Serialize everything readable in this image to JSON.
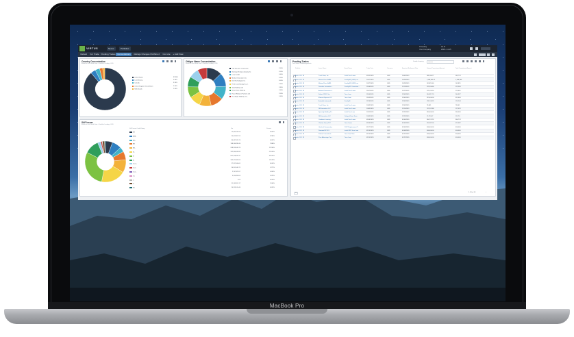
{
  "device": {
    "label": "MacBook Pro"
  },
  "app": {
    "brand": "VIRTUS",
    "breadcrumbs": [
      "Nexus",
      "Portfolios"
    ],
    "company": {
      "caption": "Company",
      "name": "Your Company",
      "date_caption": "As of",
      "date": "2019 • 11-15"
    },
    "tabs": [
      {
        "label": "Default",
        "active": false
      },
      {
        "label": "For Trade",
        "active": false
      },
      {
        "label": "Pending Trades",
        "active": false
      },
      {
        "label": "Concentrations",
        "active": true
      },
      {
        "label": "Ratings Changes",
        "active": false
      },
      {
        "label": "Portfolio 2",
        "active": false
      },
      {
        "label": "Cov Lite",
        "active": false
      },
      {
        "label": "+ Add View",
        "active": false
      }
    ],
    "country": {
      "title": "Country Concentration",
      "subtitle": "Based on Last Settle Date • Portfolio: Lending • USD",
      "legend": [
        {
          "label": "United States",
          "value": "82.86%",
          "color": "#2b3a4d"
        },
        {
          "label": "Luxembourg",
          "value": "3.58%",
          "color": "#2f7fc1"
        },
        {
          "label": "Canada",
          "value": "3.20%",
          "color": "#42b3c8"
        },
        {
          "label": "United Kingdom Great Britain",
          "value": "2.20%",
          "color": "#e6782e"
        },
        {
          "label": "Netherlands",
          "value": "1.50%",
          "color": "#f3b23b"
        }
      ]
    },
    "obligor": {
      "title": "Obligor Name Concentration",
      "subtitle": "Based on Last Settle Date • Portfolio: Lending • USD",
      "legend": [
        {
          "label": "ION Solutions Corporation",
          "value": "3.90%",
          "color": "#2b3a4d"
        },
        {
          "label": "Gateway Energy Company Inc",
          "value": "3.50%",
          "color": "#2f7fc1"
        },
        {
          "label": "Lunar Credit",
          "value": "3.40%",
          "color": "#42b3c8"
        },
        {
          "label": "Medical Innovations Inc",
          "value": "3.20%",
          "color": "#e6782e"
        },
        {
          "label": "Intel Technologies Inc",
          "value": "3.00%",
          "color": "#f3b23b"
        },
        {
          "label": "Fresh Luxembourg S.a.r.l.",
          "value": "2.90%",
          "color": "#f5d547"
        },
        {
          "label": "Total Holdings Ltd",
          "value": "2.80%",
          "color": "#7cc242"
        },
        {
          "label": "Smart Reds Holdings",
          "value": "2.60%",
          "color": "#2f9e5b"
        },
        {
          "label": "Parcel Reliance Partners Ltd",
          "value": "2.50%",
          "color": "#9ad0ec"
        },
        {
          "label": "First Eagle Holdings, Inc.",
          "value": "2.40%",
          "color": "#c63b3b"
        }
      ]
    },
    "sp": {
      "title": "S&P Issuer",
      "subtitle": "Based on Last Settle Date • Portfolio: Lending • USD",
      "col_rating": "S&P Issuer Credit Rating",
      "col_par": "Par",
      "col_pct": "Percent",
      "rows": [
        {
          "rating": "NR",
          "par": "12,462,235.98",
          "pct": "6.644%",
          "color": "#2b3a4d"
        },
        {
          "rating": "BBB-",
          "par": "20,612,857.95",
          "pct": "8.784%",
          "color": "#2f7fc1"
        },
        {
          "rating": "BB+",
          "par": "86,437,926.76",
          "pct": "4.667%",
          "color": "#42b3c8"
        },
        {
          "rating": "BB",
          "par": "138,160,283.40",
          "pct": "7.886%",
          "color": "#e6782e"
        },
        {
          "rating": "BB-",
          "par": "248,353,046.70",
          "pct": "12.200%",
          "color": "#f3b23b"
        },
        {
          "rating": "B+",
          "par": "352,369,633.83",
          "pct": "22.956%",
          "color": "#f5d547"
        },
        {
          "rating": "B",
          "par": "601,108,635.47",
          "pct": "34.992%",
          "color": "#7cc242"
        },
        {
          "rating": "B-",
          "par": "303,222,469.60",
          "pct": "13.528%",
          "color": "#2f9e5b"
        },
        {
          "rating": "CCC+",
          "par": "27,517,060.61",
          "pct": "3.002%",
          "color": "#9ad0ec"
        },
        {
          "rating": "CCC",
          "par": "20,551,543.71",
          "pct": "1.277%",
          "color": "#c63b3b"
        },
        {
          "rating": "CCC-",
          "par": "2,767,427.07",
          "pct": "0.109%",
          "color": "#7a5bb5"
        },
        {
          "rating": "CC",
          "par": "3,100,499.00",
          "pct": "0.125%",
          "color": "#d98bc0"
        },
        {
          "rating": "C",
          "par": "0.00",
          "pct": "0.000%",
          "color": "#b5b5b5"
        },
        {
          "rating": "D",
          "par": "51,145,951.17",
          "pct": "1.966%",
          "color": "#6e4c2e"
        },
        {
          "rating": "SD",
          "par": "24,319,510.44",
          "pct": "0.952%",
          "color": "#1d6b73"
        }
      ]
    },
    "trades": {
      "title": "Pending Trades",
      "subtitle": "Not Closed Trade Assignments",
      "search_placeholder": "Search",
      "grouping_label": "Disable Grouping",
      "headers": [
        "Portfolio",
        "Issuer Name",
        "Asset Name",
        "Trade Date",
        "Currency",
        "Expected Settlement Date",
        "Original Commitment Amount",
        "Total Commitment Amount"
      ],
      "rows": [
        [
          "Aretic CLO 18",
          "Truck Nano, Inc.",
          "Initial Term Loans",
          "09/25/2019",
          "USD",
          "10/03/2019",
          "581,984.77",
          "581,774"
        ],
        [
          "Aretic CLO 18",
          "Melaso Pinco SARL",
          "Facility B1 (USD) Loa",
          "10/17/2019",
          "USD",
          "10/28/2019",
          "1,958,964.52",
          "1,958,964"
        ],
        [
          "Aretic CLO 18",
          "Melaso Pinco SARL",
          "Facility B1 (USD) Loa",
          "10/17/2019",
          "USD",
          "10/28/2019",
          "143,851.46",
          "143,851"
        ],
        [
          "Aretic CLO 18",
          "Dunelme Luxembou...",
          "Facility B1 Commitme...",
          "11/06/2019",
          "USD",
          "11/15/2019",
          "222,900.66",
          "222,900"
        ],
        [
          "Aretic CLO 18",
          "Amhest Pharmaceut...",
          "Initial Term Loans",
          "11/07/2019",
          "USD",
          "11/27/2019",
          "271,320.16",
          "270,601"
        ],
        [
          "Aretic CLO 18",
          "Salient CRGT, Inc.",
          "Term Loan",
          "11/04/2019",
          "USD",
          "12/03/2019",
          "244,317.74",
          "244,317"
        ],
        [
          "Aretic CLO 18",
          "Element Express LLC",
          "Term Loan",
          "11/05/2019",
          "USD",
          "12/03/2019",
          "315,600.00",
          "315,600"
        ],
        [
          "Aretic CLO 18",
          "Autodesk Intermedi...",
          "Facility B",
          "11/26/2019",
          "USD",
          "12/03/2019",
          "151,244.29",
          "151,244"
        ],
        [
          "Aretic CLO 18",
          "Truck Nano, Inc.",
          "Initial Term Loans",
          "10/03/2019",
          "USD",
          "12/09/2019",
          "78,661",
          "78,661"
        ],
        [
          "Aretic CLO 18",
          "DEConnection LLC",
          "Initial Term Loans",
          "10/09/2019",
          "USD",
          "12/10/2019",
          "127,070.86",
          "127,070"
        ],
        [
          "Aretic CLO 18",
          "Specialty Building Pr...",
          "Initial Term Loan",
          "10/11/2019",
          "USD",
          "12/23/2019",
          "360,000.00",
          "360,000"
        ],
        [
          "Aretic CLO 18",
          "DEConnection LLC",
          "Delayed Draw Term...",
          "10/09/2019",
          "USD",
          "12/23/2019",
          "12,170.67",
          "12,170"
        ],
        [
          "Aretic CLO 18",
          "Cambium Learning ...",
          "Initial Term Loans",
          "01/06/2020",
          "USD",
          "01/06/2020",
          "364,774.52",
          "364,774"
        ],
        [
          "Aretic CLO 18",
          "Clarkon Group PLC",
          "Term Loans",
          "01/06/2020",
          "USD",
          "01/06/2020",
          "457,487.00",
          "457,487"
        ],
        [
          "Aretic CLO 18",
          "Uniclock Community...",
          "2017 Replacement T...",
          "01/17/2020",
          "USD",
          "01/06/2020",
          "600,000.00",
          "600,000"
        ],
        [
          "Aretic CLO 18",
          "Diamond BC B.V.",
          "Initial USD Term Loan",
          "01/10/2020",
          "USD",
          "01/08/2020",
          "600,000.00",
          "600,000"
        ],
        [
          "Aretic CLO 18",
          "Sirdens Internationl...",
          "Term Loan New",
          "01/10/2020",
          "USD",
          "01/22/2020",
          "600,000.00",
          "600,000"
        ],
        [
          "Aretic CLO 18",
          "Pure Advantage Cor...",
          "Term Loan",
          "01/10/2020",
          "USD",
          "01/22/2020",
          "600,000.00",
          "600,000"
        ]
      ],
      "page_size": "25",
      "page_info": "1 - 18 of 18"
    }
  },
  "chart_data": [
    {
      "type": "pie",
      "title": "Country Concentration",
      "categories": [
        "United States",
        "Luxembourg",
        "Canada",
        "United Kingdom Great Britain",
        "Netherlands"
      ],
      "values": [
        82.86,
        3.58,
        3.2,
        2.2,
        1.5
      ]
    },
    {
      "type": "pie",
      "title": "Obligor Name Concentration",
      "categories": [
        "ION Solutions Corporation",
        "Gateway Energy Company Inc",
        "Lunar Credit",
        "Medical Innovations Inc",
        "Intel Technologies Inc",
        "Fresh Luxembourg S.a.r.l.",
        "Total Holdings Ltd",
        "Smart Reds Holdings",
        "Parcel Reliance Partners Ltd",
        "First Eagle Holdings, Inc."
      ],
      "values": [
        3.9,
        3.5,
        3.4,
        3.2,
        3.0,
        2.9,
        2.8,
        2.6,
        2.5,
        2.4
      ]
    },
    {
      "type": "pie",
      "title": "S&P Issuer",
      "categories": [
        "NR",
        "BBB-",
        "BB+",
        "BB",
        "BB-",
        "B+",
        "B",
        "B-",
        "CCC+",
        "CCC",
        "CCC-",
        "CC",
        "C",
        "D",
        "SD"
      ],
      "values": [
        6.644,
        8.784,
        4.667,
        7.886,
        12.2,
        22.956,
        34.992,
        13.528,
        3.002,
        1.277,
        0.109,
        0.125,
        0.0,
        1.966,
        0.952
      ]
    }
  ]
}
